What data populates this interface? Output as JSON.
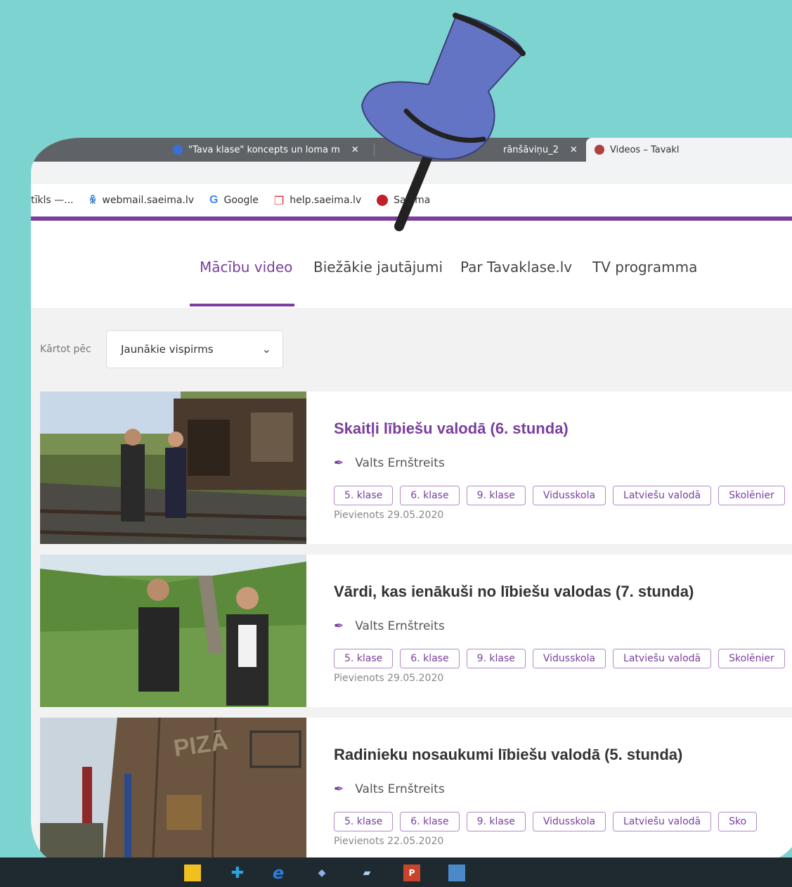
{
  "browser": {
    "tabs": [
      {
        "label": "\"Tava klase\" koncepts un loma m",
        "close": "✕"
      },
      {
        "label": "rānšāviņu_2",
        "close": "✕"
      },
      {
        "label": "Videos – Tavakl",
        "close": ""
      }
    ],
    "bookmarks": [
      {
        "label": "tīkls —..."
      },
      {
        "label": "webmail.saeima.lv"
      },
      {
        "label": "Google"
      },
      {
        "label": "help.saeima.lv"
      },
      {
        "label": "Saeima"
      }
    ]
  },
  "nav": {
    "items": [
      "Mācību video",
      "Biežākie jautājumi",
      "Par Tavaklase.lv",
      "TV programma"
    ],
    "active_index": 0
  },
  "sort": {
    "label": "Kārtot pēc",
    "value": "Jaunākie vispirms"
  },
  "videos": [
    {
      "title": "Skaitļi lībiešu valodā (6. stunda)",
      "author": "Valts Ernštreits",
      "tags": [
        "5. klase",
        "6. klase",
        "9. klase",
        "Vidusskola",
        "Latviešu valodā",
        "Skolēnier"
      ],
      "date": "Pievienots 29.05.2020"
    },
    {
      "title": "Vārdi, kas ienākuši no lībiešu valodas (7. stunda)",
      "author": "Valts Ernštreits",
      "tags": [
        "5. klase",
        "6. klase",
        "9. klase",
        "Vidusskola",
        "Latviešu valodā",
        "Skolēnier"
      ],
      "date": "Pievienots 29.05.2020"
    },
    {
      "title": "Radinieku nosaukumi lībiešu valodā (5. stunda)",
      "author": "Valts Ernštreits",
      "tags": [
        "5. klase",
        "6. klase",
        "9. klase",
        "Vidusskola",
        "Latviešu valodā",
        "Sko"
      ],
      "date": "Pievienots 22.05.2020"
    }
  ],
  "thumb_text": "PIZĀ",
  "colors": {
    "background": "#7dd3d0",
    "accent": "#7a3e9d",
    "pin": "#6474c4"
  }
}
